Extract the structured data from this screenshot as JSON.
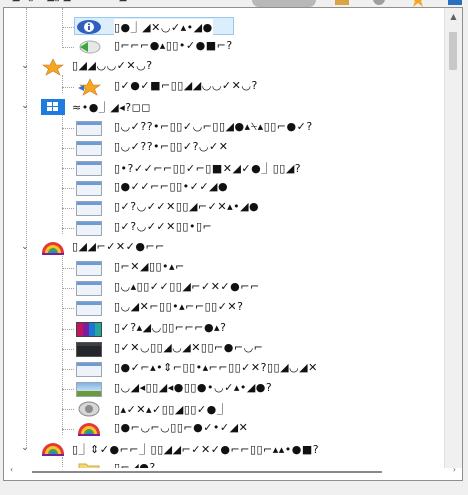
{
  "toolbar": {
    "clipped_text": "▫ ◢✕▯ ▫ ◢▯ ◢▫ ▫ ✕ ▫▫ ◢ ▫ ▫"
  },
  "colors": {
    "tree_line": "#a0a0a0",
    "selection_bg": "#dceefb",
    "selection_border": "#99c9ef",
    "scrollbar_thumb": "#c8c8c8"
  },
  "tree": {
    "items": [
      {
        "label": "▯●⏌◢✕◡✓▴•◢●",
        "icon": "info-icon",
        "expander": "",
        "selected": true
      },
      {
        "label": "▯⌐⌐⌐●▴▯▯•✓●■⌐?",
        "icon": "back-arrow-icon",
        "expander": "",
        "selected": false
      },
      {
        "label": "▯◢◢◡◡✓✕◡?",
        "icon": "star-icon",
        "expander": "⌄",
        "selected": false
      },
      {
        "label": "▯✓●✓■⌐▯▯◢◢◡◡✓✕◡?",
        "icon": "star-arrow-icon",
        "expander": "",
        "selected": false
      },
      {
        "label": "≈•●⏌◢◂?◻◻",
        "icon": "windows-icon",
        "expander": "⌄",
        "selected": false
      },
      {
        "label": "▯◡✓??•⌐▯▯✓◡⌐▯▯◢●▴⍀▴▯▯⌐●✓?",
        "icon": "window-thumb-icon",
        "expander": "",
        "selected": false
      },
      {
        "label": "▯◡✓??•⌐▯▯✓?◡✓✕",
        "icon": "window-thumb-icon",
        "expander": "",
        "selected": false
      },
      {
        "label": "▯•?✓✓⌐⌐▯▯✓⌐▯■✕◢✓●⏌▯▯◢?",
        "icon": "window-thumb-icon",
        "expander": "",
        "selected": false
      },
      {
        "label": "▯●✓✓⌐⌐▯▯•✓✓◢●",
        "icon": "window-thumb-icon",
        "expander": "",
        "selected": false
      },
      {
        "label": "▯✓?◡✓✓✕▯▯◢⌐✓✕▴•◢●",
        "icon": "window-thumb-icon",
        "expander": "",
        "selected": false
      },
      {
        "label": "▯✓?◡✓✓✕▯▯•▯⌐",
        "icon": "window-thumb-icon",
        "expander": "",
        "selected": false
      },
      {
        "label": "▯◢◢⌐✓✕✓●⌐⌐",
        "icon": "color-wheel-icon",
        "expander": "⌄",
        "selected": false
      },
      {
        "label": "▯⌐✕◢▯▯•▴⌐",
        "icon": "window-thumb-icon",
        "expander": "",
        "selected": false
      },
      {
        "label": "▯◡▴▯▯✓✓▯▯◢⌐✓✕✓●⌐⌐",
        "icon": "window-thumb-icon",
        "expander": "",
        "selected": false
      },
      {
        "label": "▯◡◢✕⌐▯▯•▴⌐⌐▯▯✓✕?",
        "icon": "window-thumb-icon",
        "expander": "",
        "selected": false
      },
      {
        "label": "▯✓?▴◢◡▯▯⌐⌐⌐●▴?",
        "icon": "color-grid-icon",
        "expander": "",
        "selected": false
      },
      {
        "label": "▯✓✕◡▯▯◢◡◢✕▯▯⌐●⌐◡⌐",
        "icon": "dark-window-icon",
        "expander": "",
        "selected": false
      },
      {
        "label": "▯●✓⌐▴•⇕⌐▯▯•▴⌐⌐▯▯✓✕?▯▯◢◡◢✕",
        "icon": "window-thumb-icon",
        "expander": "",
        "selected": false
      },
      {
        "label": "▯◡◢◂▯▯◢◂●▯▯●•◡✓▴•◢●?",
        "icon": "landscape-icon",
        "expander": "",
        "selected": false
      },
      {
        "label": "▯▴✓✕▴✓▯▯◢▯▯✓●⏌",
        "icon": "speaker-icon",
        "expander": "",
        "selected": false
      },
      {
        "label": "▯●⌐◡⌐◡▯▯⌐●✓•✓◢✕",
        "icon": "color-wheel-icon",
        "expander": "",
        "selected": false
      },
      {
        "label": "▯⏌⇕✓●⌐⌐⏌▯▯◢◢⌐✓✕✓●⌐⌐▯▯⌐▴▴•●■?",
        "icon": "color-wheel-icon",
        "expander": "⌄",
        "selected": false
      },
      {
        "label": "▯⌐◢●?",
        "icon": "folder-icon",
        "expander": "",
        "selected": false
      }
    ]
  }
}
